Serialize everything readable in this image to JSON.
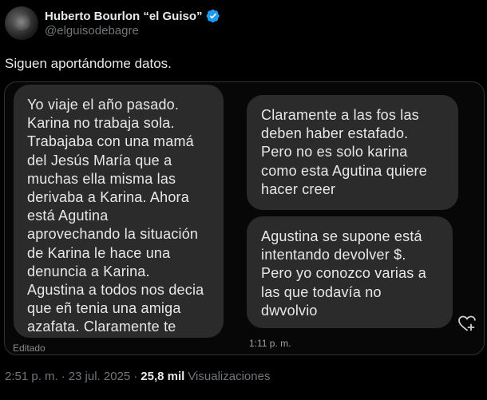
{
  "author": {
    "name": "Huberto Bourlon “el Guiso”",
    "handle": "@elguisodebagre"
  },
  "tweet": {
    "text": "Siguen aportándome datos."
  },
  "screenshot": {
    "left_bubble": {
      "lines": [
        "Yo viaje el año pasado.",
        "Karina no trabaja sola.",
        "Trabajaba con una mamá",
        "del Jesús María que a",
        "muchas ella misma las",
        "derivaba a Karina. Ahora",
        "está Agutina",
        "aprovechando la situación",
        "de Karina le hace una",
        "denuncia a Karina.",
        "Agustina a todos nos decia",
        "que eñ tenia una amiga",
        "azafata. Claramente te"
      ]
    },
    "right_bubble_1": {
      "lines": [
        "Claramente a las fos las",
        "deben haber estafado.",
        "Pero no es solo karina",
        "como esta Agutina quiere",
        "hacer creer"
      ]
    },
    "right_bubble_2": {
      "lines": [
        "Agustina se supone está",
        "intentando devolver $.",
        "Pero yo conozco varias a",
        "las que todavía no",
        "dwvolvio"
      ]
    },
    "edited_label": "Editado",
    "message_time": "1:11 p. m.",
    "react_icon": "heart-plus-icon"
  },
  "footer": {
    "time": "2:51 p. m.",
    "separator": "·",
    "date": "23 jul. 2025",
    "views_count": "25,8 mil",
    "views_label": "Visualizaciones"
  },
  "colors": {
    "background": "#000000",
    "text": "#e7e9ea",
    "muted": "#71767b",
    "bubble": "#2b2b2b",
    "verified": "#1d9bf0"
  }
}
